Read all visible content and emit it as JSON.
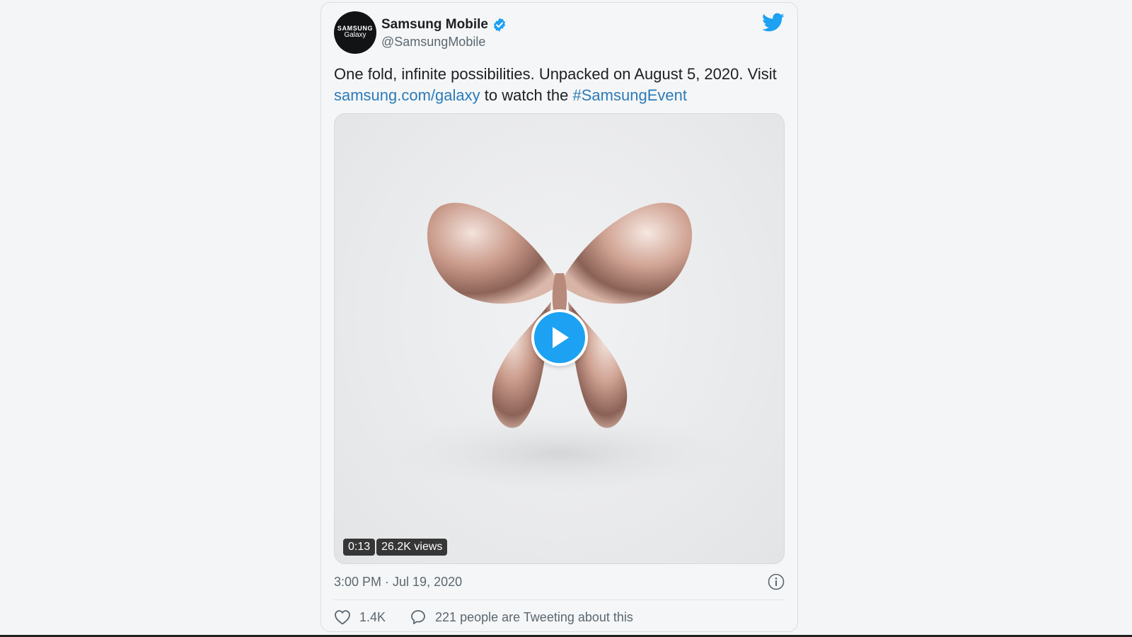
{
  "tweet": {
    "author": {
      "avatar_brand": "SAMSUNG",
      "avatar_sub": "Galaxy",
      "display_name": "Samsung Mobile",
      "handle": "@SamsungMobile",
      "verified": true
    },
    "text_part1": "One fold, infinite possibilities. Unpacked on August 5, 2020. Visit ",
    "link_text": "samsung.com/galaxy",
    "text_part2": " to watch the ",
    "hashtag": "#SamsungEvent",
    "video": {
      "duration": "0:13",
      "views": "26.2K views"
    },
    "timestamp": "3:00 PM · Jul 19, 2020",
    "likes": "1.4K",
    "conversation": "221 people are Tweeting about this"
  },
  "colors": {
    "accent": "#1da1f2",
    "link": "#2b7bb9",
    "text": "#1c2022",
    "muted": "#5b6770"
  },
  "icons": [
    "verified-badge-icon",
    "twitter-bird-icon",
    "play-icon",
    "info-icon",
    "heart-icon",
    "speech-bubble-icon"
  ]
}
